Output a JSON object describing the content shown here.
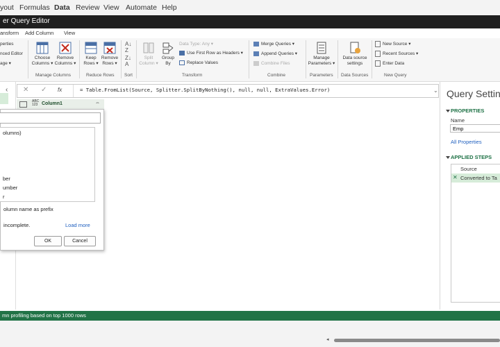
{
  "excel_menu": [
    "yout",
    "Formulas",
    "Data",
    "Review",
    "View",
    "Automate",
    "Help"
  ],
  "window_title": "er Query Editor",
  "ribbon_tabs": [
    "ansform",
    "Add Column",
    "View"
  ],
  "ribbon": {
    "left_partial": [
      "perties",
      "nced Editor",
      "age ▾"
    ],
    "choose_columns": "Choose\nColumns ▾",
    "remove_columns": "Remove\nColumns ▾",
    "manage_columns_label": "Manage Columns",
    "keep_rows": "Keep\nRows ▾",
    "remove_rows": "Remove\nRows ▾",
    "reduce_rows_label": "Reduce Rows",
    "sort_label": "Sort",
    "split_column": "Split\nColumn ▾",
    "group_by": "Group\nBy",
    "data_type": "Data Type: Any ▾",
    "use_first_row": "Use First Row as Headers ▾",
    "replace_values": "Replace Values",
    "transform_label": "Transform",
    "merge_queries": "Merge Queries ▾",
    "append_queries": "Append Queries ▾",
    "combine_files": "Combine Files",
    "combine_label": "Combine",
    "manage_parameters": "Manage\nParameters ▾",
    "parameters_label": "Parameters",
    "data_source_settings": "Data source\nsettings",
    "data_sources_label": "Data Sources",
    "new_source": "New Source ▾",
    "recent_sources": "Recent Sources ▾",
    "enter_data": "Enter Data",
    "new_query_label": "New Query"
  },
  "formula_bar": {
    "fx": "fx",
    "formula": "= Table.FromList(Source, Splitter.SplitByNothing(), null, null, ExtraValues.Error)"
  },
  "grid": {
    "type_badge_top": "ABC",
    "type_badge_bottom": "123",
    "column_name": "Column1"
  },
  "popup": {
    "list_items": [
      "olumns)",
      "ber",
      "umber",
      "r"
    ],
    "prefix_option": "olumn name as prefix",
    "incomplete_msg": "incomplete.",
    "load_more": "Load more",
    "ok": "OK",
    "cancel": "Cancel"
  },
  "query_settings": {
    "title": "Query Settings",
    "properties_header": "PROPERTIES",
    "name_label": "Name",
    "name_value": "Emp",
    "all_properties": "All Properties",
    "applied_steps_header": "APPLIED STEPS",
    "steps": [
      "Source",
      "Converted to Ta"
    ]
  },
  "status_bar": "mn profiling based on top 1000 rows",
  "colors": {
    "status_green": "#217346",
    "title_bar": "#1f1f1f",
    "accent_green": "#1e7145"
  }
}
